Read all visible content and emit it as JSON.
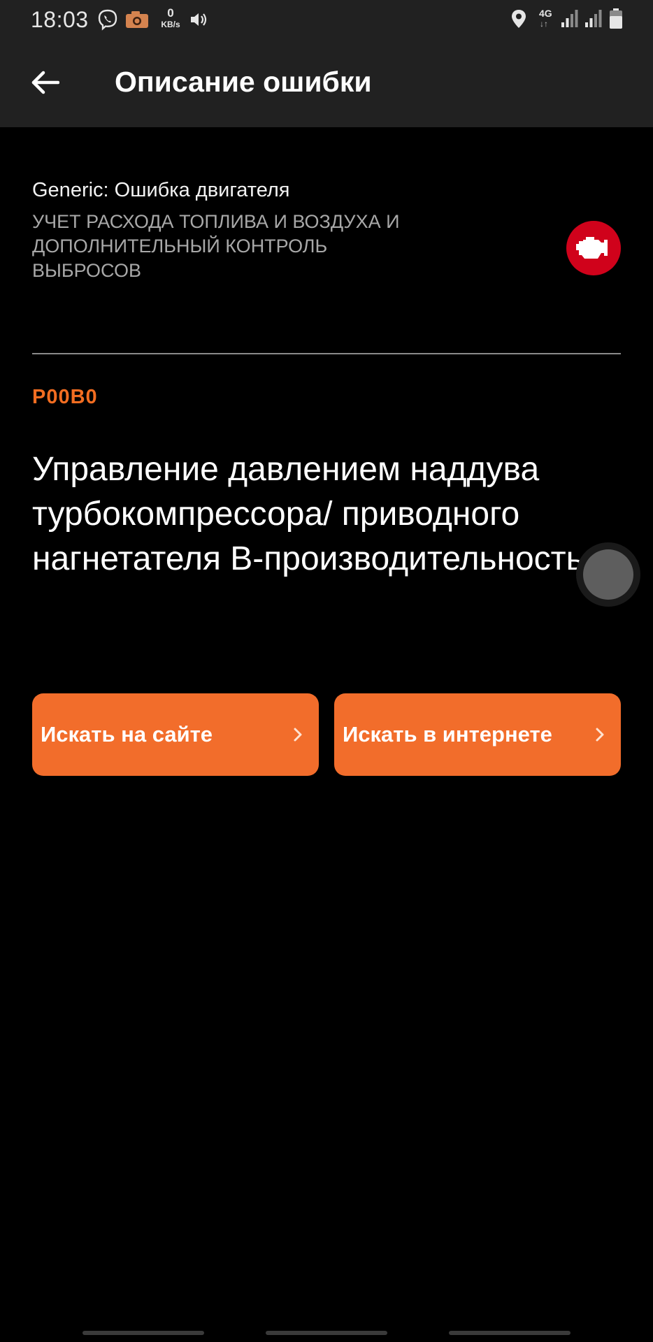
{
  "status_bar": {
    "time": "18:03",
    "net_speed_value": "0",
    "net_speed_unit": "KB/s",
    "network_type": "4G",
    "network_arrows": "↓↑",
    "icons": [
      "viber-icon",
      "camera-app-icon",
      "volume-icon",
      "location-icon",
      "signal-icon",
      "signal-icon-2",
      "battery-icon"
    ]
  },
  "app_bar": {
    "back_icon": "arrow-left-icon",
    "title": "Описание ошибки"
  },
  "error": {
    "category": "Generic: Ошибка двигателя",
    "subsystem": "УЧЕТ РАСХОДА ТОПЛИВА И ВОЗДУХА И ДОПОЛНИТЕЛЬНЫЙ КОНТРОЛЬ ВЫБРОСОВ",
    "badge_icon": "check-engine-icon",
    "code": "P00B0",
    "description": "Управление давлением наддува турбокомпрессора/ приводного нагнетателя B-производительность"
  },
  "actions": {
    "search_site_label": "Искать на сайте",
    "search_web_label": "Искать в интернете",
    "chevron_icon": "chevron-right-icon"
  },
  "colors": {
    "accent": "#f26d2b",
    "code_color": "#f26d21",
    "badge_red": "#d0021b",
    "appbar_bg": "#212121",
    "background": "#000000"
  }
}
